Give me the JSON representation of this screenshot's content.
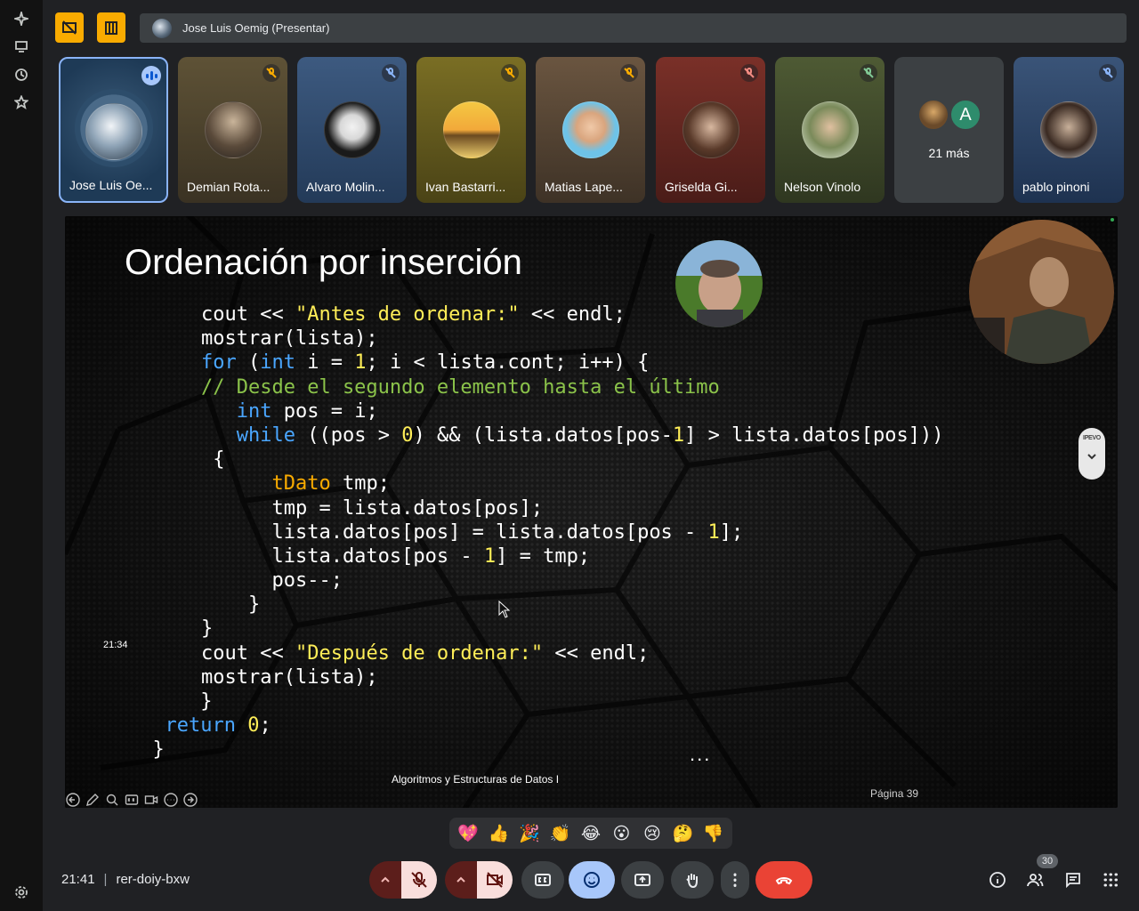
{
  "top": {
    "presenter_label": "Jose Luis Oemig (Presentar)"
  },
  "participants": [
    {
      "name": "Jose Luis Oe...",
      "state": "speaking"
    },
    {
      "name": "Demian Rota...",
      "state": "muted"
    },
    {
      "name": "Alvaro Molin...",
      "state": "muted"
    },
    {
      "name": "Ivan Bastarri...",
      "state": "muted"
    },
    {
      "name": "Matias Lape...",
      "state": "muted"
    },
    {
      "name": "Griselda Gi...",
      "state": "muted"
    },
    {
      "name": "Nelson Vinolo",
      "state": "muted"
    },
    {
      "name": "pablo pinoni",
      "state": "muted"
    }
  ],
  "more_tile": {
    "avatar_letter": "A",
    "label": "21 más"
  },
  "slide": {
    "title": "Ordenación por inserción",
    "code_lines": [
      [
        {
          "t": "cout << ",
          "c": ""
        },
        {
          "t": "\"Antes de ordenar:\"",
          "c": "str"
        },
        {
          "t": " << endl;",
          "c": ""
        }
      ],
      [
        {
          "t": "mostrar(lista);",
          "c": ""
        }
      ],
      [
        {
          "t": "for",
          "c": "kw"
        },
        {
          "t": " (",
          "c": ""
        },
        {
          "t": "int",
          "c": "kw"
        },
        {
          "t": " i = ",
          "c": ""
        },
        {
          "t": "1",
          "c": "num"
        },
        {
          "t": "; i < lista.cont; i++) {",
          "c": ""
        }
      ],
      [
        {
          "t": "// Desde el segundo elemento hasta el último",
          "c": "cmt"
        }
      ],
      [
        {
          "t": "   ",
          "c": ""
        },
        {
          "t": "int",
          "c": "kw"
        },
        {
          "t": " pos = i;",
          "c": ""
        }
      ],
      [
        {
          "t": "   ",
          "c": ""
        },
        {
          "t": "while",
          "c": "kw"
        },
        {
          "t": " ((pos > ",
          "c": ""
        },
        {
          "t": "0",
          "c": "num"
        },
        {
          "t": ") && (lista.datos[pos-",
          "c": ""
        },
        {
          "t": "1",
          "c": "num"
        },
        {
          "t": "] > lista.datos[pos]))",
          "c": ""
        }
      ],
      [
        {
          "t": " {",
          "c": ""
        }
      ],
      [
        {
          "t": "      ",
          "c": ""
        },
        {
          "t": "tDato",
          "c": "ty"
        },
        {
          "t": " tmp;",
          "c": ""
        }
      ],
      [
        {
          "t": "      tmp = lista.datos[pos];",
          "c": ""
        }
      ],
      [
        {
          "t": "      lista.datos[pos] = lista.datos[pos - ",
          "c": ""
        },
        {
          "t": "1",
          "c": "num"
        },
        {
          "t": "];",
          "c": ""
        }
      ],
      [
        {
          "t": "      lista.datos[pos - ",
          "c": ""
        },
        {
          "t": "1",
          "c": "num"
        },
        {
          "t": "] = tmp;",
          "c": ""
        }
      ],
      [
        {
          "t": "      pos--;",
          "c": ""
        }
      ],
      [
        {
          "t": "    }",
          "c": ""
        }
      ],
      [
        {
          "t": "}",
          "c": ""
        }
      ],
      [
        {
          "t": "cout << ",
          "c": ""
        },
        {
          "t": "\"Después de ordenar:\"",
          "c": "str"
        },
        {
          "t": " << endl;",
          "c": ""
        }
      ],
      [
        {
          "t": "mostrar(lista);",
          "c": ""
        }
      ],
      [
        {
          "t": "   }",
          "c": ""
        }
      ],
      [
        {
          "t": "return",
          "c": "kw"
        },
        {
          "t": " ",
          "c": ""
        },
        {
          "t": "0",
          "c": "num"
        },
        {
          "t": ";",
          "c": ""
        }
      ],
      [
        {
          "t": "  }",
          "c": ""
        }
      ]
    ],
    "code_indents": [
      0,
      0,
      0,
      0,
      0,
      0,
      0,
      0,
      0,
      0,
      0,
      0,
      0,
      0,
      0,
      0,
      -1,
      -1,
      -2
    ],
    "timestamp": "21:34",
    "ellipsis": "...",
    "footer": "Algoritmos y Estructuras de Datos I",
    "page": "Página 39",
    "ipevo_label": "IPEVO"
  },
  "reactions": [
    "💖",
    "👍",
    "🎉",
    "👏",
    "😂",
    "😮",
    "😢",
    "🤔",
    "👎"
  ],
  "bottom": {
    "time": "21:41",
    "separator": "|",
    "meeting_code": "rer-doiy-bxw",
    "participant_count": "30"
  },
  "colors": {
    "accent_yellow": "#f9ab00",
    "end_call": "#ea4335",
    "active_blue": "#a8c7fa",
    "muted_red_bg": "#f9dedc"
  }
}
